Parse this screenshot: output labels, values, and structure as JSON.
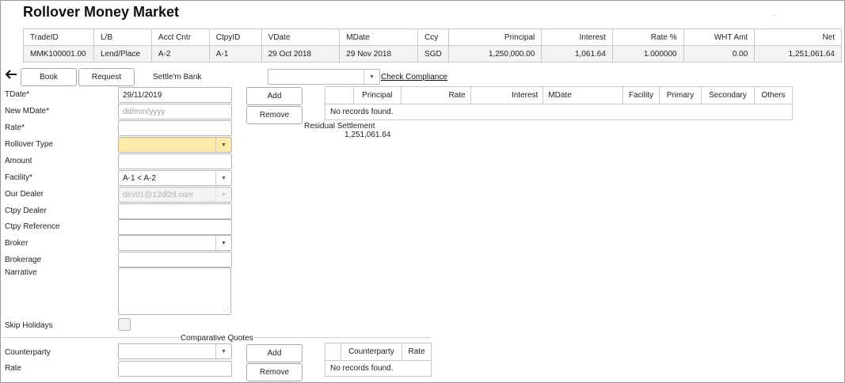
{
  "page": {
    "title": "Rollover Money Market",
    "corner_mark": "."
  },
  "trade": {
    "columns": [
      "TradeID",
      "L/B",
      "Acct Cntr",
      "CtpyID",
      "VDate",
      "MDate",
      "Ccy",
      "Principal",
      "Interest",
      "Rate %",
      "WHT Amt",
      "Net"
    ],
    "row": [
      "MMK100001.00",
      "Lend/Place",
      "A-2",
      "A-1",
      "29 Oct 2018",
      "29 Nov 2018",
      "SGD",
      "1,250,000.00",
      "1,061.64",
      "1.000000",
      "0.00",
      "1,251,061.64"
    ]
  },
  "toolbar": {
    "back_icon": "arrow-left-icon",
    "book_label": "Book",
    "request_label": "Request",
    "settle_bank_label": "Settle'm Bank",
    "settle_bank_value": "",
    "check_compliance_label": "Check Compliance"
  },
  "form": {
    "tdate": {
      "label": "TDate*",
      "value": "29/11/2019"
    },
    "new_mdate": {
      "label": "New MDate*",
      "placeholder": "dd/mm/yyyy"
    },
    "rate": {
      "label": "Rate*",
      "value": ""
    },
    "rollover_type": {
      "label": "Rollover Type",
      "value": ""
    },
    "amount": {
      "label": "Amount",
      "value": ""
    },
    "facility": {
      "label": "Facility*",
      "value": "A-1 < A-2"
    },
    "our_dealer": {
      "label": "Our Dealer",
      "value": "dev01@12dl2d.com"
    },
    "ctpy_dealer": {
      "label": "Ctpy Dealer",
      "value": ""
    },
    "ctpy_reference": {
      "label": "Ctpy Reference",
      "value": ""
    },
    "broker": {
      "label": "Broker",
      "value": ""
    },
    "brokerage": {
      "label": "Brokerage",
      "value": ""
    },
    "narrative": {
      "label": "Narrative",
      "value": ""
    },
    "skip_holidays": {
      "label": "Skip Holidays",
      "checked": false
    }
  },
  "settlement": {
    "add_label": "Add",
    "remove_label": "Remove",
    "columns": [
      "",
      "Principal",
      "Rate",
      "Interest",
      "MDate",
      "Facility",
      "Primary",
      "Secondary",
      "Others"
    ],
    "empty_text": "No records found.",
    "residual_label": "Residual Settlement",
    "residual_value": "1,251,061.64"
  },
  "quotes": {
    "section_title": "Comparative Quotes",
    "counterparty_label": "Counterparty",
    "rate_label": "Rate",
    "add_label": "Add",
    "remove_label": "Remove",
    "columns": [
      "",
      "Counterparty",
      "Rate"
    ],
    "empty_text": "No records found."
  },
  "icons": {
    "dropdown": "chevron-down-icon",
    "resize": "resize-grip-icon"
  }
}
